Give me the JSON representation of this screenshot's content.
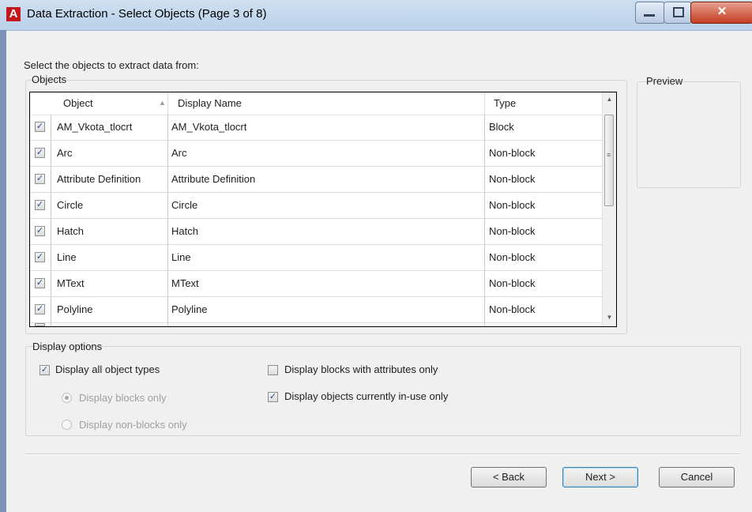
{
  "window": {
    "title": "Data Extraction - Select Objects (Page 3 of 8)",
    "app_icon_letter": "A"
  },
  "instruction": "Select the objects to extract data from:",
  "objects_group_label": "Objects",
  "preview_label": "Preview",
  "columns": [
    "Object",
    "Display Name",
    "Type"
  ],
  "rows": [
    {
      "object": "AM_Vkota_tlocrt",
      "display_name": "AM_Vkota_tlocrt",
      "type": "Block",
      "checked": true
    },
    {
      "object": "Arc",
      "display_name": "Arc",
      "type": "Non-block",
      "checked": true
    },
    {
      "object": "Attribute Definition",
      "display_name": "Attribute Definition",
      "type": "Non-block",
      "checked": true
    },
    {
      "object": "Circle",
      "display_name": "Circle",
      "type": "Non-block",
      "checked": true
    },
    {
      "object": "Hatch",
      "display_name": "Hatch",
      "type": "Non-block",
      "checked": true
    },
    {
      "object": "Line",
      "display_name": "Line",
      "type": "Non-block",
      "checked": true
    },
    {
      "object": "MText",
      "display_name": "MText",
      "type": "Non-block",
      "checked": true
    },
    {
      "object": "Polyline",
      "display_name": "Polyline",
      "type": "Non-block",
      "checked": true
    }
  ],
  "display_options": {
    "label": "Display options",
    "all_types": {
      "label": "Display all object types",
      "checked": true
    },
    "blocks_only": {
      "label": "Display blocks only",
      "selected": true,
      "enabled": false
    },
    "non_blocks_only": {
      "label": "Display non-blocks only",
      "selected": false,
      "enabled": false
    },
    "blocks_with_attributes": {
      "label": "Display blocks with attributes only",
      "checked": false
    },
    "in_use_only": {
      "label": "Display objects currently in-use only",
      "checked": true
    }
  },
  "buttons": {
    "back": "< Back",
    "next": "Next >",
    "cancel": "Cancel"
  },
  "colors": {
    "title_bar": "#b9d1ea",
    "close_button": "#c43c22",
    "app_icon": "#c4161c",
    "check_mark": "#2a4d8a"
  }
}
